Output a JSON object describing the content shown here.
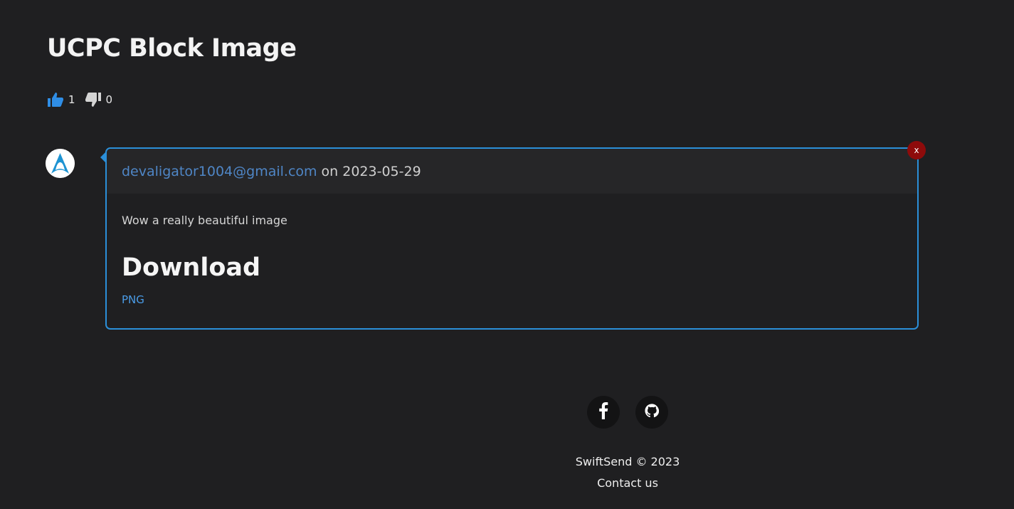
{
  "post": {
    "title": "UCPC Block Image",
    "likes": "1",
    "dislikes": "0"
  },
  "comment": {
    "author": "devaligator1004@gmail.com",
    "date_text": "on 2023-05-29",
    "text": "Wow a really beautiful image",
    "download_heading": "Download",
    "download_link": "PNG",
    "close_label": "x"
  },
  "footer": {
    "copyright": "SwiftSend © 2023",
    "contact": "Contact us",
    "social": [
      "facebook-icon",
      "github-icon"
    ]
  },
  "colors": {
    "background": "#1f1f21",
    "accent": "#2b8fd9",
    "author_link": "#4f86c6",
    "like_icon": "#2f8ee6",
    "close_button": "#8e0b0b"
  }
}
